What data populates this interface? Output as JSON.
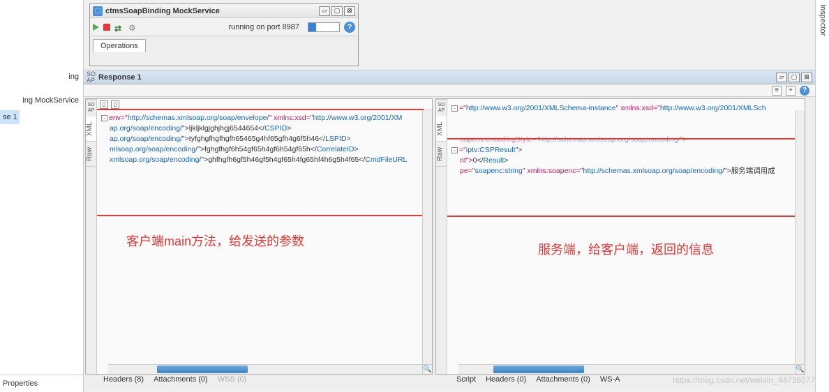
{
  "left_sidebar": {
    "item1": "ing",
    "item2": "ing MockService",
    "item3": "se 1",
    "properties": "Properties"
  },
  "inspector": {
    "label": "Inspector"
  },
  "mock": {
    "title": "ctmsSoapBinding MockService",
    "status": "running on port 8987",
    "ops_tab": "Operations"
  },
  "response": {
    "title": "Response 1",
    "vtabs": {
      "xml": "XML",
      "raw": "Raw",
      "soap": "SO\nAP"
    },
    "left_code": {
      "l1a": "env=\"",
      "l1u": "http://schemas.xmlsoap.org/soap/envelope/",
      "l1b": "\" xmlns:xsd=\"",
      "l1u2": "http://www.w3.org/2001/XM",
      "l2a": "ap.org/soap/encoding/",
      "l2t": "\">ljkljklgjghjhgj6544654</",
      "l2e": "CSPID",
      "l2c": ">",
      "l3a": "ap.org/soap/encoding/",
      "l3t": "\">tyfghgfhgfhgfh65465g4hf65gfh4g6f5h46</",
      "l3e": "LSPID",
      "l3c": ">",
      "l4a": "mlsoap.org/soap/encoding/",
      "l4t": "\">fghgfhgf6h54gf65h4gf6h54gf65h</",
      "l4e": "CorrelateID",
      "l4c": ">",
      "l5a": "xmlsoap.org/soap/encoding/",
      "l5t": "\">ghfhgfh6gf5h46gf5h4gf65h4fg65hf4h6g5h4f65</",
      "l5e": "CmdFileURL"
    },
    "right_code": {
      "r1a": "=\"",
      "r1u": "http://www.w3.org/2001/XMLSchema-instance",
      "r1b": "\" xmlns:xsd=\"",
      "r1u2": "http://www.w3.org/2001/XMLSch",
      "r2a": "oapenv:encodingStyle=\"",
      "r2u": "http://schemas.xmlsoap.org/soap/encoding/",
      "r2c": "\">",
      "r3a": "=\"",
      "r3v": "iptv:CSPResult",
      "r3c": "\">",
      "r4a": "nt\">",
      "r4v": "0",
      "r4b": "</",
      "r4e": "Result",
      "r4c": ">",
      "r5a": "pe=\"",
      "r5v": "soapenc:string",
      "r5b": "\" xmlns:soapenc=\"",
      "r5u": "http://schemas.xmlsoap.org/soap/encoding/",
      "r5c": "\">服务端调用成"
    },
    "annot_left": "客户端main方法，给发送的参数",
    "annot_right": "服务端，给客户端，返回的信息",
    "bottom_left": {
      "headers": "Headers (8)",
      "attach": "Attachments (0)",
      "wss": "WSS (0)"
    },
    "bottom_right": {
      "script": "Script",
      "headers": "Headers (0)",
      "attach": "Attachments (0)",
      "wsa": "WS-A"
    }
  },
  "watermark": "https://blog.csdn.net/weixin_44736077"
}
